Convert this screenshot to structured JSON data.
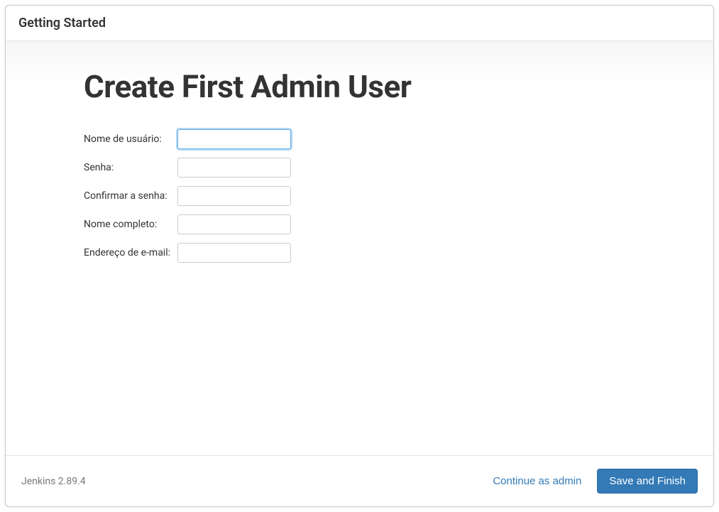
{
  "header": {
    "title": "Getting Started"
  },
  "main": {
    "heading": "Create First Admin User",
    "fields": {
      "username": {
        "label": "Nome de usuário:",
        "value": ""
      },
      "password": {
        "label": "Senha:",
        "value": ""
      },
      "confirm_password": {
        "label": "Confirmar a senha:",
        "value": ""
      },
      "fullname": {
        "label": "Nome completo:",
        "value": ""
      },
      "email": {
        "label": "Endereço de e-mail:",
        "value": ""
      }
    }
  },
  "footer": {
    "version": "Jenkins 2.89.4",
    "continue_label": "Continue as admin",
    "save_label": "Save and Finish"
  }
}
